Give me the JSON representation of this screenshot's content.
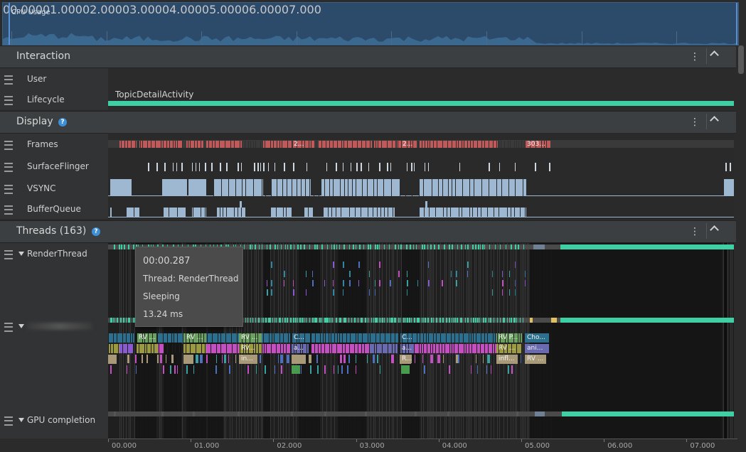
{
  "cpu_panel": {
    "title": "CPU Usage",
    "ticks": [
      "00.000",
      "01.000",
      "02.000",
      "03.000",
      "04.000",
      "05.000",
      "06.000",
      "07.000"
    ]
  },
  "sections": {
    "interaction": {
      "title": "Interaction"
    },
    "display": {
      "title": "Display"
    },
    "threads": {
      "title": "Threads (163)"
    }
  },
  "rows": {
    "user": "User",
    "lifecycle": "Lifecycle",
    "frames": "Frames",
    "surfaceflinger": "SurfaceFlinger",
    "vsync": "VSYNC",
    "bufferqueue": "BufferQueue",
    "renderthread": "RenderThread",
    "gpu_completion": "GPU completion"
  },
  "lifecycle_activity": "TopicDetailActivity",
  "frame_labels": [
    "2...",
    "2...",
    "303..."
  ],
  "slice_labels": [
    "RV ...",
    "RV ...",
    "RV ...",
    "C...",
    "C...",
    "RV P...",
    "Cho...",
    "RV...",
    "a...",
    "a...",
    "RV ...",
    "ani...",
    "in...",
    "R...",
    "infl...",
    "RV ..."
  ],
  "tooltip": {
    "time": "00:00.287",
    "thread": "Thread: RenderThread",
    "state": "Sleeping",
    "duration": "13.24 ms"
  },
  "bottom_axis": {
    "ticks": [
      "00.000",
      "01.000",
      "02.000",
      "03.000",
      "04.000",
      "05.000",
      "06.000",
      "07.000"
    ]
  },
  "colors": {
    "accent_teal": "#3fcfa4",
    "frames_red": "#c0595a",
    "vsync_blue": "#9db8d0",
    "cpu_bg": "#2c4a6a"
  }
}
